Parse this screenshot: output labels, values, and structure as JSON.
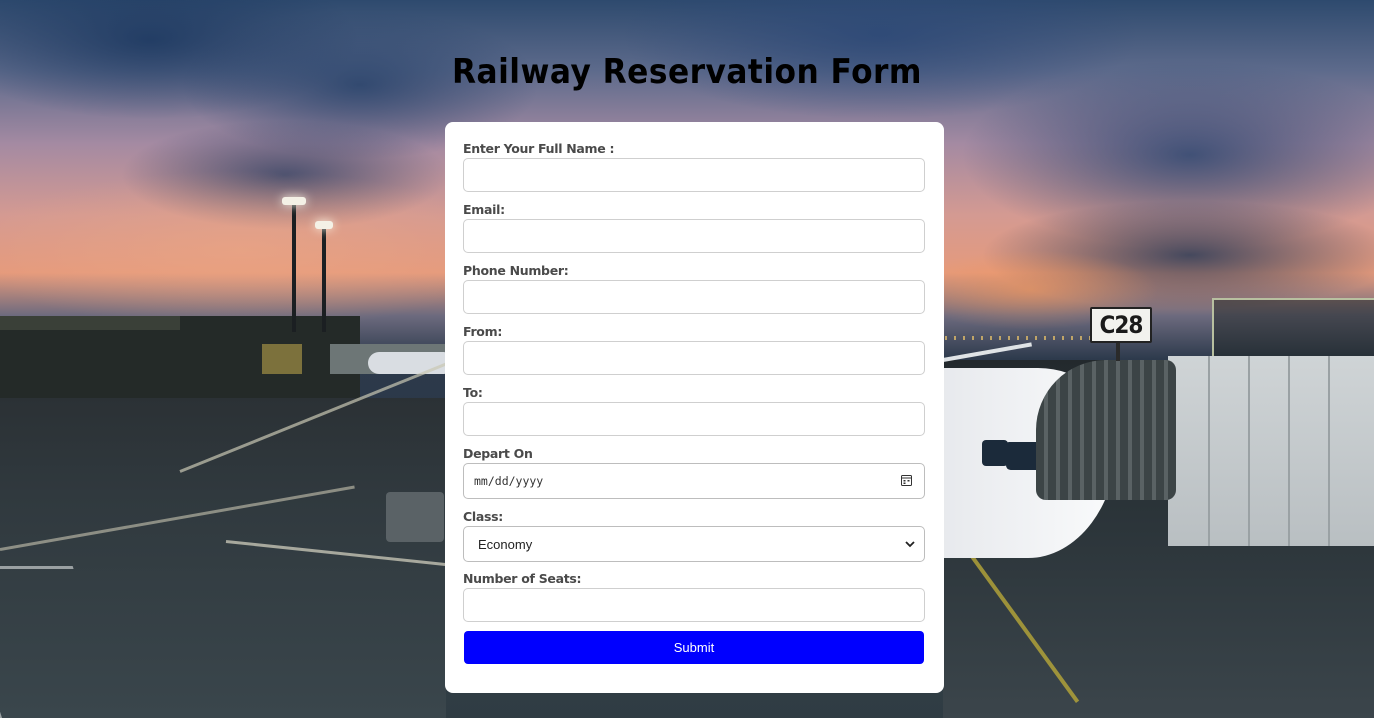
{
  "page": {
    "title": "Railway Reservation Form"
  },
  "scene": {
    "gate_sign": "C28"
  },
  "form": {
    "fields": [
      {
        "label": "Enter Your Full Name :",
        "value": ""
      },
      {
        "label": "Email:",
        "value": ""
      },
      {
        "label": "Phone Number:",
        "value": ""
      },
      {
        "label": "From:",
        "value": ""
      },
      {
        "label": "To:",
        "value": ""
      }
    ],
    "depart": {
      "label": "Depart On",
      "placeholder": "mm/dd/yyyy"
    },
    "class": {
      "label": "Class:",
      "selected": "Economy"
    },
    "seats": {
      "label": "Number of Seats:",
      "value": ""
    },
    "submit_label": "Submit"
  },
  "colors": {
    "submit_bg": "#0000ff",
    "card_bg": "#ffffff"
  },
  "icons": {
    "date": "calendar-icon",
    "select": "chevron-down-icon"
  }
}
